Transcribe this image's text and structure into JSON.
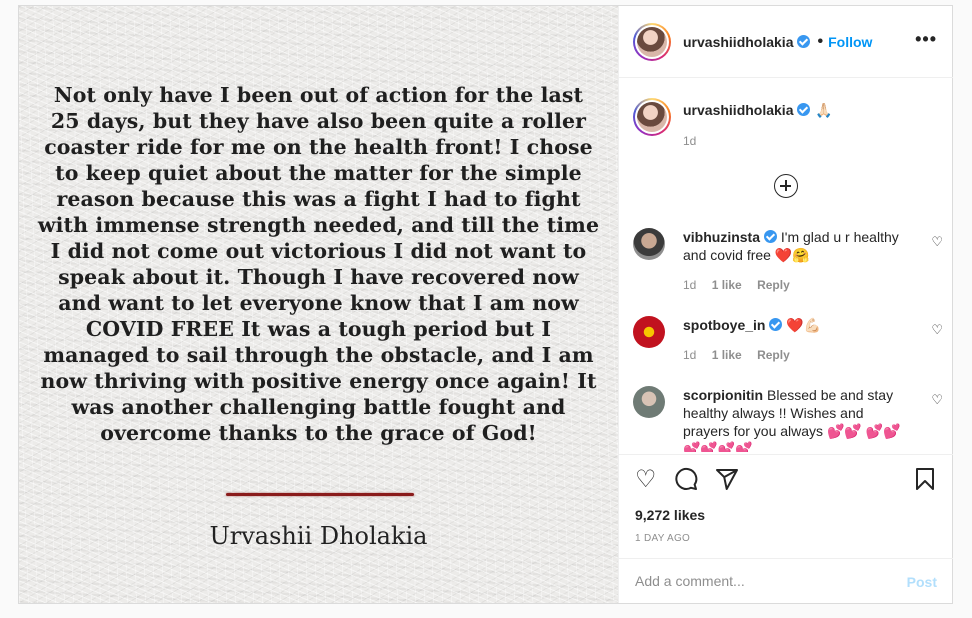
{
  "post_image": {
    "quote_lines": [
      "Not only have I been out of action for the last",
      "25 days, but they have also been quite a roller",
      "coaster ride for me on the health front! I chose",
      "to keep quiet about the matter for the simple",
      "reason because this was a fight I had to fight",
      "with immense strength needed, and till the time",
      "I did not come out victorious I did not want to",
      "speak about it. Though I have recovered now",
      "and want to let everyone know that I am now",
      "COVID FREE It was a tough period but I",
      "managed to sail through the obstacle, and I am",
      "now thriving with positive energy once again! It",
      "was another challenging battle fought and",
      "overcome thanks to the grace of God!"
    ],
    "signature": "Urvashii Dholakia",
    "rule_color": "#8a1b1b"
  },
  "header": {
    "username": "urvashiidholakia",
    "separator": "•",
    "follow_label": "Follow",
    "more_icon": "more-horizontal-icon",
    "more_glyph": "•••"
  },
  "caption": {
    "username": "urvashiidholakia",
    "text": "🙏🏻",
    "time": "1d"
  },
  "load_more_icon": "plus-circle-icon",
  "comments": [
    {
      "username": "vibhuzinsta",
      "verified": true,
      "text": "I'm glad u r healthy and covid free ❤️🤗",
      "time": "1d",
      "likes": "1 like",
      "reply": "Reply"
    },
    {
      "username": "spotboye_in",
      "verified": true,
      "text": "❤️💪🏻",
      "time": "1d",
      "likes": "1 like",
      "reply": "Reply"
    },
    {
      "username": "scorpionitin",
      "verified": false,
      "text": "Blessed be and stay healthy always !! Wishes and prayers for you always 💕💕 💕💕💕💕💕💕",
      "time": "",
      "likes": "",
      "reply": ""
    }
  ],
  "actions": {
    "icons": [
      "heart-icon",
      "comment-icon",
      "share-icon",
      "bookmark-icon"
    ],
    "likes": "9,272 likes",
    "posted": "1 DAY AGO"
  },
  "add_comment": {
    "placeholder": "Add a comment...",
    "post_label": "Post"
  },
  "colors": {
    "accent": "#0095f6",
    "post_disabled": "#b2dffc",
    "verified": "#3897f0",
    "muted": "#8e8e8e"
  }
}
